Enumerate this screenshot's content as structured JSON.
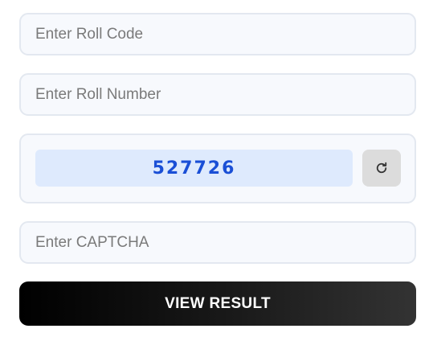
{
  "form": {
    "roll_code_placeholder": "Enter Roll Code",
    "roll_number_placeholder": "Enter Roll Number",
    "captcha": {
      "code": "527726",
      "refresh_icon": "refresh-icon"
    },
    "captcha_placeholder": "Enter CAPTCHA",
    "submit_label": "VIEW RESULT"
  },
  "colors": {
    "field_background": "#f7f9fd",
    "field_border": "#e3e8f0",
    "captcha_background": "#deeafd",
    "captcha_text": "#1a4fd6",
    "refresh_button": "#dcdcdc",
    "submit_button": "#000000",
    "submit_text": "#ffffff"
  }
}
